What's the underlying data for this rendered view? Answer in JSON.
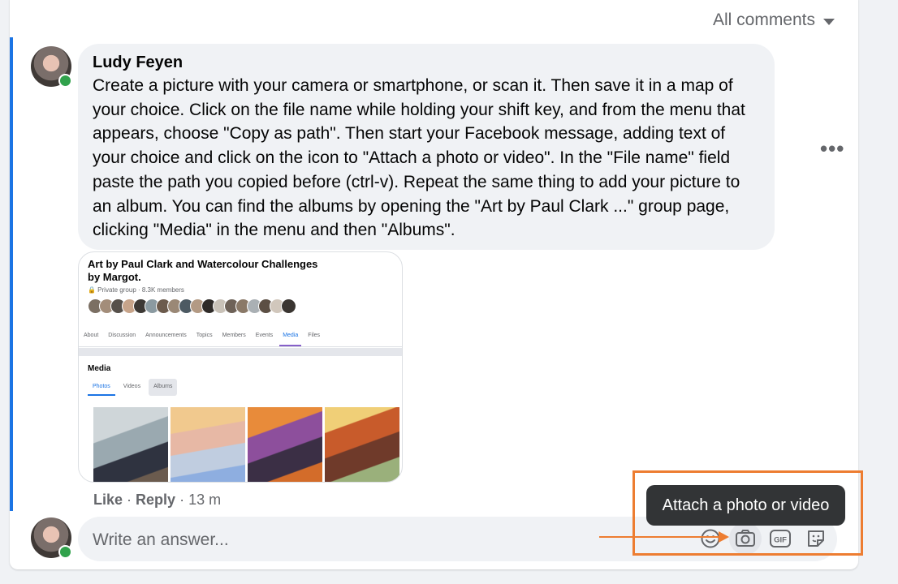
{
  "header": {
    "filter_label": "All comments"
  },
  "comment": {
    "author": "Ludy Feyen",
    "text": "Create a picture with your camera or smartphone, or scan it. Then save it in a map of your choice. Click on the file name while holding your shift key, and from the menu that appears, choose \"Copy as path\". Then start your Facebook message, adding text of your choice and click on the icon to \"Attach a photo or video\". In the \"File name\" field paste the path you copied before (ctrl-v). Repeat the same thing to add your picture to an album. You can find the albums by opening the \"Art by Paul Clark ...\" group page, clicking \"Media\" in the menu and then \"Albums\".",
    "more_label": "•••",
    "actions": {
      "like": "Like",
      "separator": " · ",
      "reply": "Reply",
      "time": "13 m"
    }
  },
  "attachment": {
    "group_title": "Art by Paul Clark and Watercolour Challenges by Margot.",
    "group_meta": "🔒 Private group · 8.3K members",
    "tabs": [
      "About",
      "Discussion",
      "Announcements",
      "Topics",
      "Members",
      "Events",
      "Media",
      "Files"
    ],
    "active_tab": "Media",
    "section_title": "Media",
    "subtabs": [
      "Photos",
      "Videos",
      "Albums"
    ]
  },
  "composer": {
    "placeholder": "Write an answer...",
    "tools": [
      "emoji-icon",
      "camera-icon",
      "gif-icon",
      "sticker-icon"
    ]
  },
  "tooltip": {
    "text": "Attach a photo or video"
  },
  "colors": {
    "accent": "#1b74e4",
    "annotation": "#ed7d31",
    "online": "#31a24c"
  }
}
